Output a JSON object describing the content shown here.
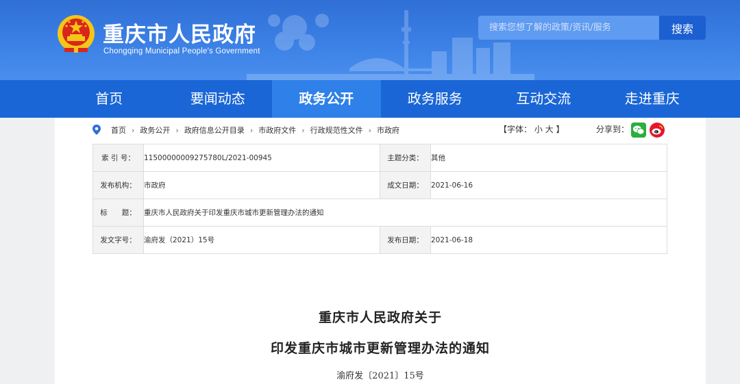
{
  "header": {
    "title": "重庆市人民政府",
    "subtitle": "Chongqing Municipal People's Government",
    "search_placeholder": "搜索您想了解的政策/资讯/服务",
    "search_button": "搜索"
  },
  "nav": {
    "items": [
      "首页",
      "要闻动态",
      "政务公开",
      "政务服务",
      "互动交流",
      "走进重庆"
    ],
    "active": "政务公开"
  },
  "breadcrumb": [
    "首页",
    "政务公开",
    "政府信息公开目录",
    "市政府文件",
    "行政规范性文件",
    "市政府"
  ],
  "toolbar": {
    "font_label": "【字体：",
    "font_small": "小",
    "font_large": "大",
    "font_close": "】",
    "share_label": "分享到："
  },
  "meta": {
    "index_label": "索 引 号：",
    "index_value": "11500000009275780L/2021-00945",
    "topic_label": "主题分类：",
    "topic_value": "其他",
    "org_label": "发布机构：",
    "org_value": "市政府",
    "made_label": "成文日期：",
    "made_value": "2021-06-16",
    "title_label": "标　　题：",
    "title_value": "重庆市人民政府关于印发重庆市城市更新管理办法的通知",
    "docno_label": "发文字号：",
    "docno_value": "渝府发（2021）15号",
    "pub_label": "发布日期：",
    "pub_value": "2021-06-18"
  },
  "document": {
    "title_line1": "重庆市人民政府关于",
    "title_line2": "印发重庆市城市更新管理办法的通知",
    "doc_number": "渝府发〔2021〕15号"
  },
  "colors": {
    "header_blue": "#3d82e6",
    "nav_blue": "#1a66d6",
    "nav_active": "#2f80e8",
    "wechat_green": "#2aae3e",
    "weibo_red": "#e6162d"
  }
}
